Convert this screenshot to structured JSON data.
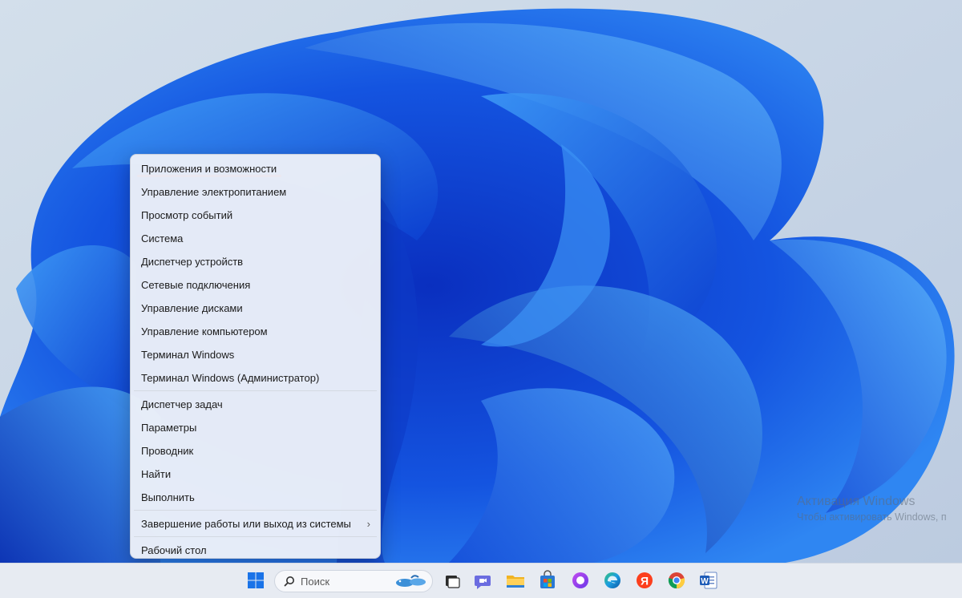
{
  "menu": {
    "group1": [
      "Приложения и возможности",
      "Управление электропитанием",
      "Просмотр событий",
      "Система",
      "Диспетчер устройств",
      "Сетевые подключения",
      "Управление дисками",
      "Управление компьютером",
      "Терминал Windows",
      "Терминал Windows (Администратор)"
    ],
    "group2": [
      "Диспетчер задач",
      "Параметры",
      "Проводник",
      "Найти",
      "Выполнить"
    ],
    "shutdown": "Завершение работы или выход из системы",
    "submenu_arrow": "›",
    "desktop": "Рабочий стол",
    "highlight_color": "#d8141b"
  },
  "activation": {
    "title": "Активация Windows",
    "subtitle": "Чтобы активировать Windows, п"
  },
  "taskbar": {
    "search_placeholder": "Поиск",
    "icons": [
      "start-icon",
      "search-icon",
      "task-view-icon",
      "chat-icon",
      "file-explorer-icon",
      "store-icon",
      "alice-icon",
      "edge-icon",
      "yandex-browser-icon",
      "chrome-icon",
      "word-icon"
    ]
  }
}
